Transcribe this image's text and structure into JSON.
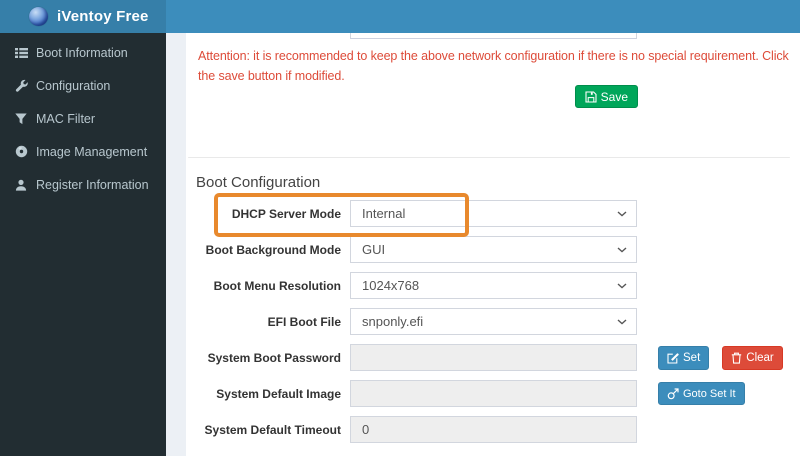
{
  "header": {
    "title": "iVentoy Free"
  },
  "sidebar": {
    "items": [
      {
        "label": "Boot Information",
        "icon": "list-icon"
      },
      {
        "label": "Configuration",
        "icon": "wrench-icon"
      },
      {
        "label": "MAC Filter",
        "icon": "filter-icon"
      },
      {
        "label": "Image Management",
        "icon": "disc-icon"
      },
      {
        "label": "Register Information",
        "icon": "user-icon"
      }
    ]
  },
  "notice": {
    "text": "Attention: it is recommended to keep the above network configuration if there is no special requirement. Click the save button if modified."
  },
  "save_button": {
    "label": "Save",
    "icon": "floppy-icon"
  },
  "boot_config": {
    "title": "Boot Configuration",
    "rows": [
      {
        "label": "DHCP Server Mode",
        "type": "select",
        "value": "Internal",
        "highlighted": true
      },
      {
        "label": "Boot Background Mode",
        "type": "select",
        "value": "GUI"
      },
      {
        "label": "Boot Menu Resolution",
        "type": "select",
        "value": "1024x768"
      },
      {
        "label": "EFI Boot File",
        "type": "select",
        "value": "snponly.efi"
      },
      {
        "label": "System Boot Password",
        "type": "input",
        "value": "",
        "disabled": true
      },
      {
        "label": "System Default Image",
        "type": "input",
        "value": "",
        "disabled": true
      },
      {
        "label": "System Default Timeout",
        "type": "input",
        "value": "0",
        "disabled": true
      }
    ],
    "actions": {
      "set": {
        "label": "Set",
        "icon": "edit-icon"
      },
      "clear": {
        "label": "Clear",
        "icon": "trash-icon"
      },
      "goto": {
        "label": "Goto Set It",
        "icon": "mars-icon"
      }
    }
  },
  "colors": {
    "header_blue": "#3c8dbc",
    "logo_blue": "#367fa9",
    "sidebar_dark": "#222d32",
    "sidebar_text": "#b8c7ce",
    "notice_red": "#dd4b39",
    "save_green": "#00a65a",
    "button_blue": "#3c8dbc",
    "button_red": "#dd4b39",
    "highlight_orange": "#e8892d"
  }
}
